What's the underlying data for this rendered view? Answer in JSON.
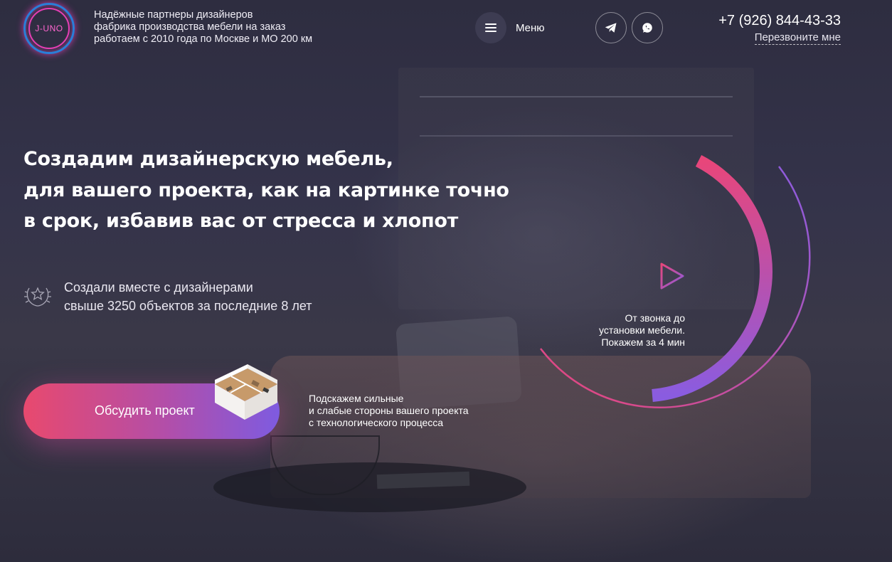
{
  "header": {
    "logo_text": "J-UNO",
    "tagline": [
      "Надёжные партнеры дизайнеров",
      "фабрика производства мебели на заказ",
      "работаем с 2010 года по Москве и МО 200 км"
    ],
    "menu_label": "Меню",
    "social": [
      {
        "icon": "telegram-icon"
      },
      {
        "icon": "whatsapp-icon"
      }
    ],
    "phone": "+7 (926) 844-43-33",
    "callback_label": "Перезвоните мне"
  },
  "hero": {
    "headline": [
      "Создадим дизайнерскую мебель,",
      "для вашего проекта, как на картинке точно",
      "в срок, избавив вас от стресса и хлопот"
    ],
    "achievement": [
      "Создали вместе с дизайнерами",
      "свыше 3250 объектов за последние 8 лет"
    ],
    "cta_label": "Обсудить проект",
    "hint": [
      "Подскажем сильные",
      "и слабые стороны вашего проекта",
      "с технологического процесса"
    ],
    "video_caption": [
      "От звонка до",
      "установки мебели.",
      "Покажем за 4 мин"
    ]
  },
  "colors": {
    "accent_pink": "#e8496e",
    "accent_purple": "#7e5be0",
    "logo_pink": "#e53fb4",
    "logo_blue": "#2a7fd8"
  }
}
